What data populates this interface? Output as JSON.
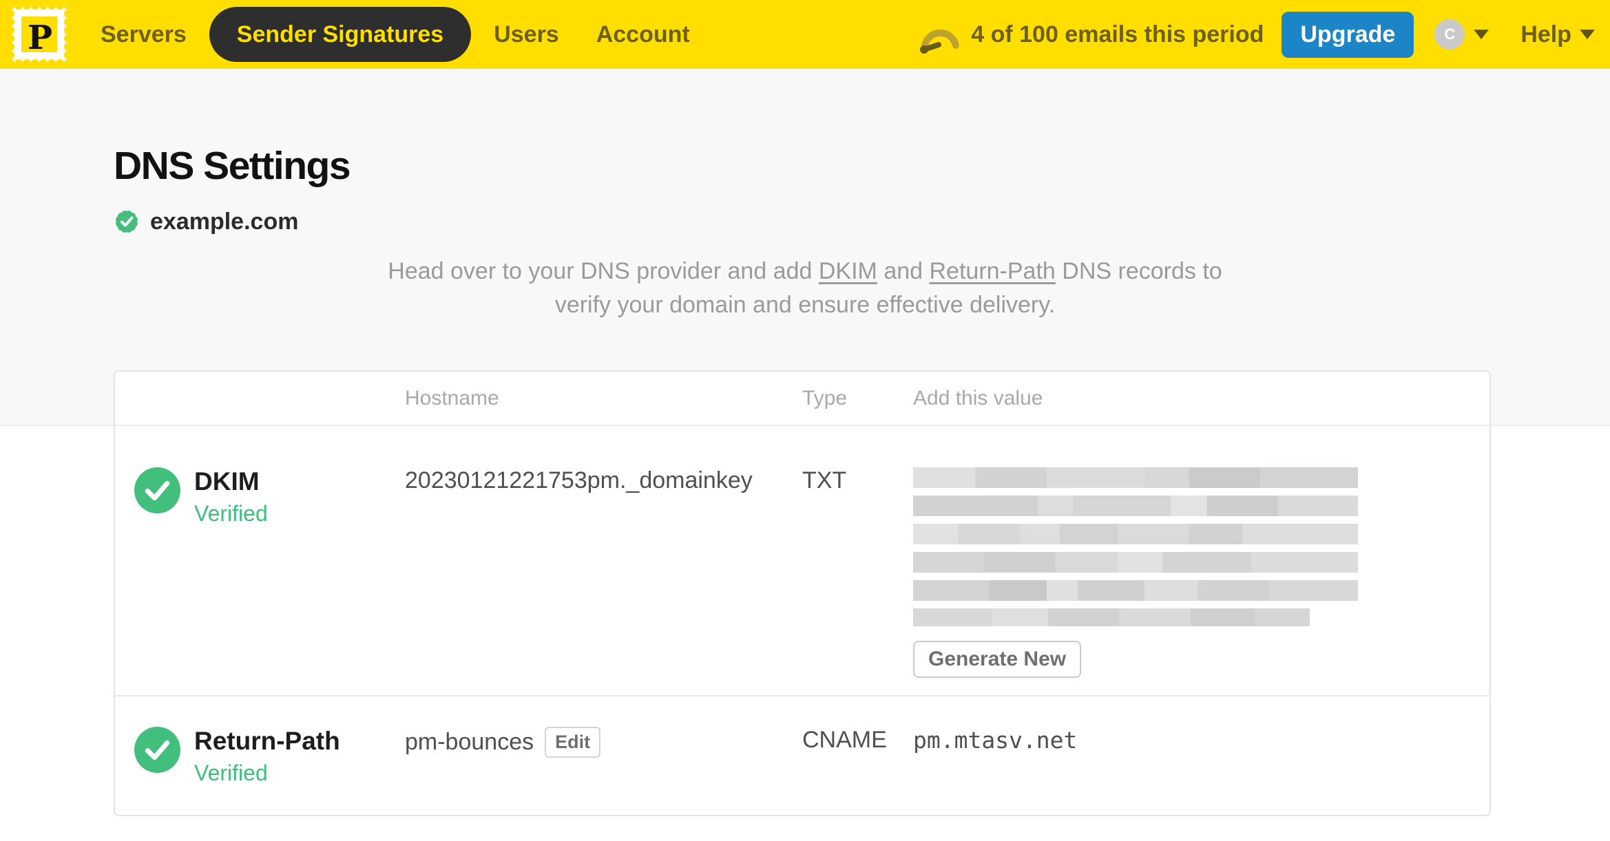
{
  "navbar": {
    "logo_letter": "P",
    "items": [
      {
        "label": "Servers",
        "active": false
      },
      {
        "label": "Sender Signatures",
        "active": true
      },
      {
        "label": "Users",
        "active": false
      },
      {
        "label": "Account",
        "active": false
      }
    ],
    "usage_text": "4 of 100 emails this period",
    "upgrade_label": "Upgrade",
    "avatar_initial": "C",
    "help_label": "Help"
  },
  "page": {
    "title": "DNS Settings",
    "domain": "example.com",
    "domain_verified": true,
    "intro": {
      "part1": "Head over to your DNS provider and add ",
      "link_dkim": "DKIM",
      "part2": " and ",
      "link_return_path": "Return-Path",
      "part3": " DNS records to verify your domain and ensure effective delivery."
    }
  },
  "table": {
    "headers": {
      "hostname": "Hostname",
      "type": "Type",
      "value": "Add this value"
    },
    "rows": [
      {
        "name": "DKIM",
        "status": "Verified",
        "hostname": "20230121221753pm._domainkey",
        "type": "TXT",
        "value": "",
        "value_redacted": true,
        "action_label": "Generate New"
      },
      {
        "name": "Return-Path",
        "status": "Verified",
        "hostname": "pm-bounces",
        "edit_label": "Edit",
        "type": "CNAME",
        "value": "pm.mtasv.net"
      }
    ]
  },
  "colors": {
    "brand_yellow": "#FFDE00",
    "accent_blue": "#1B85C8",
    "success_green": "#42BE7D",
    "nav_text_olive": "#6E5F1B"
  }
}
